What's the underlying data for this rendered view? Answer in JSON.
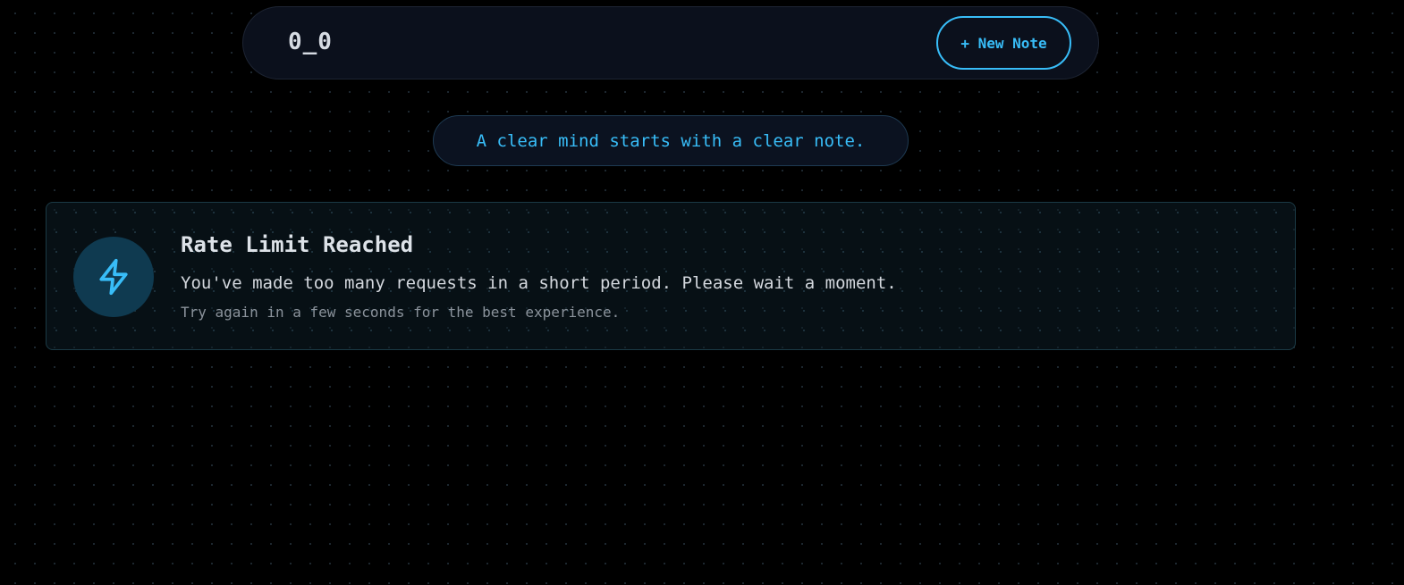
{
  "navbar": {
    "brand": "0_0",
    "new_note_label": "+ New Note"
  },
  "tagline": {
    "text": "A clear mind starts with a clear note."
  },
  "alert": {
    "icon": "lightning-bolt-icon",
    "title": "Rate Limit Reached",
    "message": "You've made too many requests in a short period. Please wait a moment.",
    "hint": "Try again in a few seconds for the best experience."
  },
  "colors": {
    "accent": "#38bdf8",
    "background": "#000000",
    "navbar_bg": "#0b101c",
    "icon_circle_bg": "#0f3a50"
  }
}
